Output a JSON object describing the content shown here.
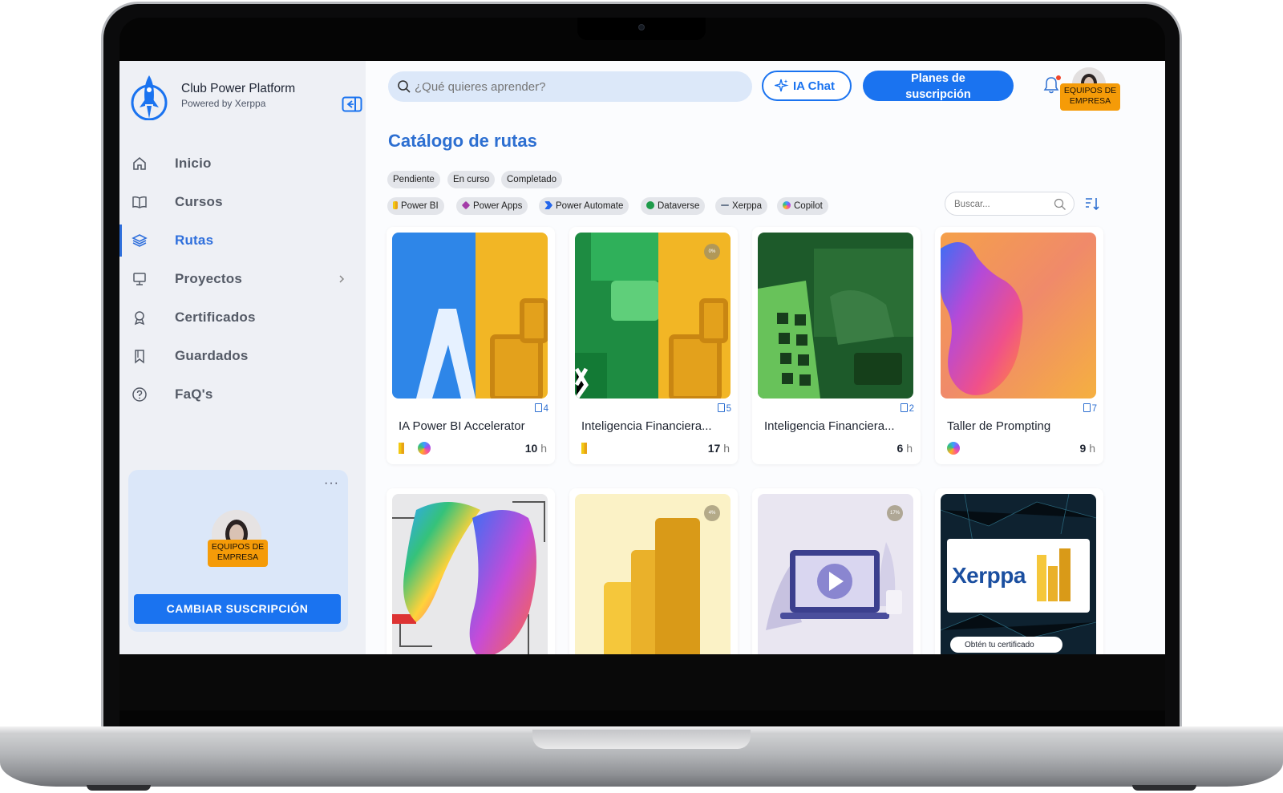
{
  "brand": {
    "title": "Club Power Platform",
    "subtitle": "Powered by Xerppa"
  },
  "nav": [
    {
      "label": "Inicio",
      "icon": "home-icon"
    },
    {
      "label": "Cursos",
      "icon": "book-icon"
    },
    {
      "label": "Rutas",
      "icon": "layers-icon",
      "active": true
    },
    {
      "label": "Proyectos",
      "icon": "presentation-icon"
    },
    {
      "label": "Certificados",
      "icon": "award-icon"
    },
    {
      "label": "Guardados",
      "icon": "bookmark-icon"
    },
    {
      "label": "FaQ's",
      "icon": "help-icon"
    }
  ],
  "promo": {
    "badge_line1": "EQUIPOS DE",
    "badge_line2": "EMPRESA",
    "button": "CAMBIAR SUSCRIPCIÓN"
  },
  "header": {
    "search_placeholder": "¿Qué quieres aprender?",
    "ia_chat": "IA Chat",
    "planes_line1": "Planes de",
    "planes_line2": "suscripción",
    "badge_line1": "EQUIPOS DE",
    "badge_line2": "EMPRESA"
  },
  "page": {
    "title": "Catálogo de rutas"
  },
  "status_filters": [
    "Pendiente",
    "En curso",
    "Completado"
  ],
  "tech_filters": [
    "Power BI",
    "Power Apps",
    "Power Automate",
    "Dataverse",
    "Xerppa",
    "Copilot"
  ],
  "mini_search_placeholder": "Buscar...",
  "cards": [
    {
      "count": "4",
      "title": "IA Power BI Accelerator",
      "hours": "10",
      "unit": "h"
    },
    {
      "count": "5",
      "title": "Inteligencia Financiera...",
      "hours": "17",
      "unit": "h",
      "progress": "0%"
    },
    {
      "count": "2",
      "title": "Inteligencia Financiera...",
      "hours": "6",
      "unit": "h"
    },
    {
      "count": "7",
      "title": "Taller de Prompting",
      "hours": "9",
      "unit": "h"
    }
  ],
  "row2": {
    "pct_1": "4%",
    "pct_2": "17%",
    "xerppa_logo": "Xerppa",
    "certificate_text": "Obtén tu certificado"
  },
  "colors": {
    "accent": "#1a73f0",
    "title": "#2d6fd1",
    "badge": "#f59b08"
  }
}
